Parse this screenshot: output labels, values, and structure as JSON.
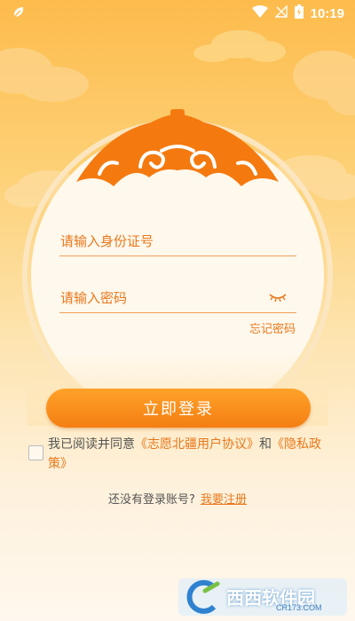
{
  "status_bar": {
    "time": "10:19",
    "icons": [
      "app-leaf-icon",
      "wifi-icon",
      "signal-off-icon",
      "battery-charging-icon"
    ]
  },
  "login": {
    "id_placeholder": "请输入身份证号",
    "password_placeholder": "请输入密码",
    "forgot_password": "忘记密码",
    "login_button": "立即登录"
  },
  "agreement": {
    "prefix": "我已阅读并同意",
    "user_agreement": "《志愿北疆用户协议》",
    "and": "和",
    "privacy_policy": "《隐私政策》"
  },
  "register": {
    "prompt": "还没有登录账号?",
    "link": "我要注册"
  },
  "watermark": {
    "brand": "西西软件园",
    "url": "CR173.COM"
  },
  "colors": {
    "accent": "#f47e12",
    "text_orange": "#e8781c",
    "bg_top": "#fdbb4c",
    "bg_bottom": "#fff8ee"
  }
}
